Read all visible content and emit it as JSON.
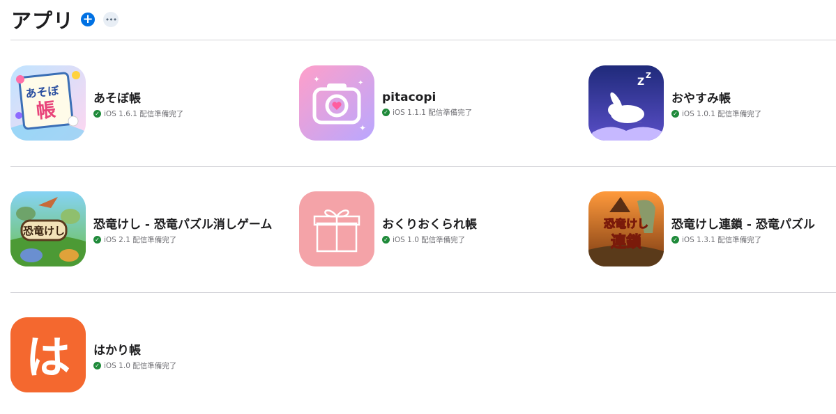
{
  "header": {
    "title": "アプリ",
    "add_icon": "plus-icon",
    "more_icon": "ellipsis-icon"
  },
  "apps": [
    {
      "name": "あそぼ帳",
      "version": "iOS 1.6.1 配信準備完了",
      "icon": "asobo-icon",
      "icon_text": "あそぼ帳"
    },
    {
      "name": "pitacopi",
      "version": "iOS 1.1.1 配信準備完了",
      "icon": "camera-icon"
    },
    {
      "name": "おやすみ帳",
      "version": "iOS 1.0.1 配信準備完了",
      "icon": "sleeping-bunny-icon"
    },
    {
      "name": "恐竜けし - 恐竜パズル消しゲーム",
      "version": "iOS 2.1 配信準備完了",
      "icon": "dinosaur-icon",
      "icon_text": "恐竜けし"
    },
    {
      "name": "おくりおくられ帳",
      "version": "iOS 1.0 配信準備完了",
      "icon": "gift-icon"
    },
    {
      "name": "恐竜けし連鎖 - 恐竜パズル",
      "version": "iOS 1.3.1 配信準備完了",
      "icon": "dinosaur-chain-icon",
      "icon_text": "恐竜けし連鎖"
    },
    {
      "name": "はかり帳",
      "version": "iOS 1.0 配信準備完了",
      "icon": "hakari-icon",
      "icon_text": "は"
    }
  ],
  "colors": {
    "accent": "#0071e3",
    "status_ok": "#1f8a3a"
  }
}
